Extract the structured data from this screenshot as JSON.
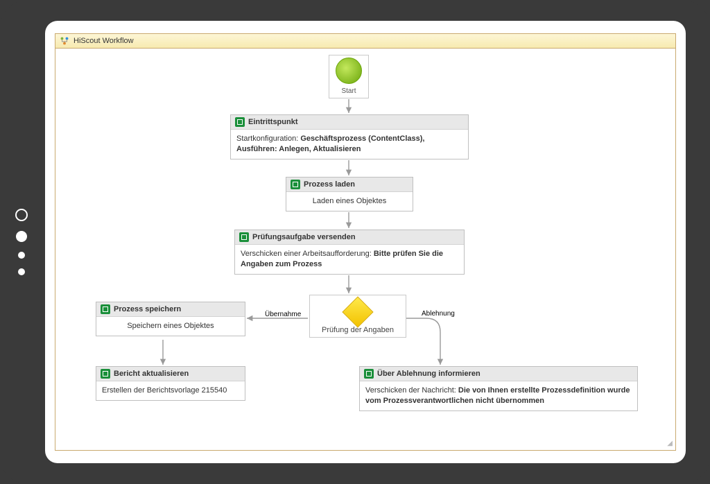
{
  "panel": {
    "title": "HiScout Workflow"
  },
  "start": {
    "label": "Start"
  },
  "activities": {
    "entry": {
      "title": "Eintrittspunkt",
      "body_prefix": "Startkonfiguration: ",
      "body_bold": "Geschäftsprozess (ContentClass), Ausführen: Anlegen, Aktualisieren"
    },
    "load": {
      "title": "Prozess laden",
      "body": "Laden eines Objektes"
    },
    "send": {
      "title": "Prüfungsaufgabe versenden",
      "body_prefix": "Verschicken einer Arbeitsaufforderung: ",
      "body_bold": "Bitte prüfen Sie die Angaben zum Prozess"
    },
    "save": {
      "title": "Prozess speichern",
      "body": "Speichern eines Objektes"
    },
    "report": {
      "title": "Bericht aktualisieren",
      "body": "Erstellen der Berichtsvorlage 215540"
    },
    "reject": {
      "title": "Über Ablehnung informieren",
      "body_prefix": "Verschicken der Nachricht: ",
      "body_bold": "Die von Ihnen erstellte Prozessdefinition wurde vom Prozessverantwortlichen nicht übernommen"
    }
  },
  "decision": {
    "label": "Prüfung der Angaben"
  },
  "edges": {
    "accept": "Übernahme",
    "reject": "Ablehnung"
  }
}
